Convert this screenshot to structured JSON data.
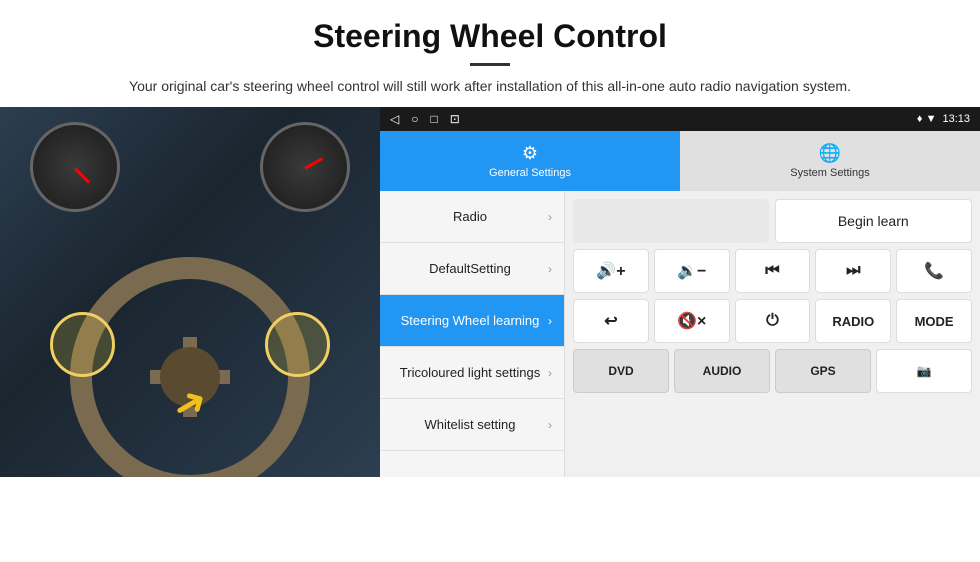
{
  "header": {
    "title": "Steering Wheel Control",
    "subtitle": "Your original car's steering wheel control will still work after installation of this all-in-one auto radio navigation system.",
    "divider": true
  },
  "status_bar": {
    "left_icons": [
      "◁",
      "○",
      "□",
      "⊡"
    ],
    "right_icons": "♦ ▼",
    "time": "13:13"
  },
  "tabs": [
    {
      "id": "general",
      "label": "General Settings",
      "icon": "⚙",
      "active": true
    },
    {
      "id": "system",
      "label": "System Settings",
      "icon": "⊕",
      "active": false
    }
  ],
  "menu_items": [
    {
      "id": "radio",
      "label": "Radio",
      "active": false
    },
    {
      "id": "default",
      "label": "DefaultSetting",
      "active": false
    },
    {
      "id": "steering",
      "label": "Steering Wheel learning",
      "active": true
    },
    {
      "id": "tricoloured",
      "label": "Tricoloured light settings",
      "active": false
    },
    {
      "id": "whitelist",
      "label": "Whitelist setting",
      "active": false
    }
  ],
  "right_panel": {
    "begin_learn_label": "Begin learn",
    "row1": [
      {
        "id": "vol_up",
        "label": "🔊+",
        "sym": true
      },
      {
        "id": "vol_down",
        "label": "🔉−",
        "sym": true
      },
      {
        "id": "prev",
        "label": "⏮",
        "sym": true
      },
      {
        "id": "next",
        "label": "⏭",
        "sym": true
      },
      {
        "id": "phone",
        "label": "📞",
        "sym": true
      }
    ],
    "row2": [
      {
        "id": "hang_up",
        "label": "↩",
        "sym": true
      },
      {
        "id": "mute",
        "label": "🔇×",
        "sym": true
      },
      {
        "id": "power",
        "label": "⏻",
        "sym": true
      },
      {
        "id": "radio_btn",
        "label": "RADIO",
        "sym": false
      },
      {
        "id": "mode_btn",
        "label": "MODE",
        "sym": false
      }
    ],
    "row3": [
      {
        "id": "dvd",
        "label": "DVD",
        "sym": false
      },
      {
        "id": "audio",
        "label": "AUDIO",
        "sym": false
      },
      {
        "id": "gps",
        "label": "GPS",
        "sym": false
      },
      {
        "id": "cam",
        "label": "📷",
        "sym": true
      }
    ]
  }
}
